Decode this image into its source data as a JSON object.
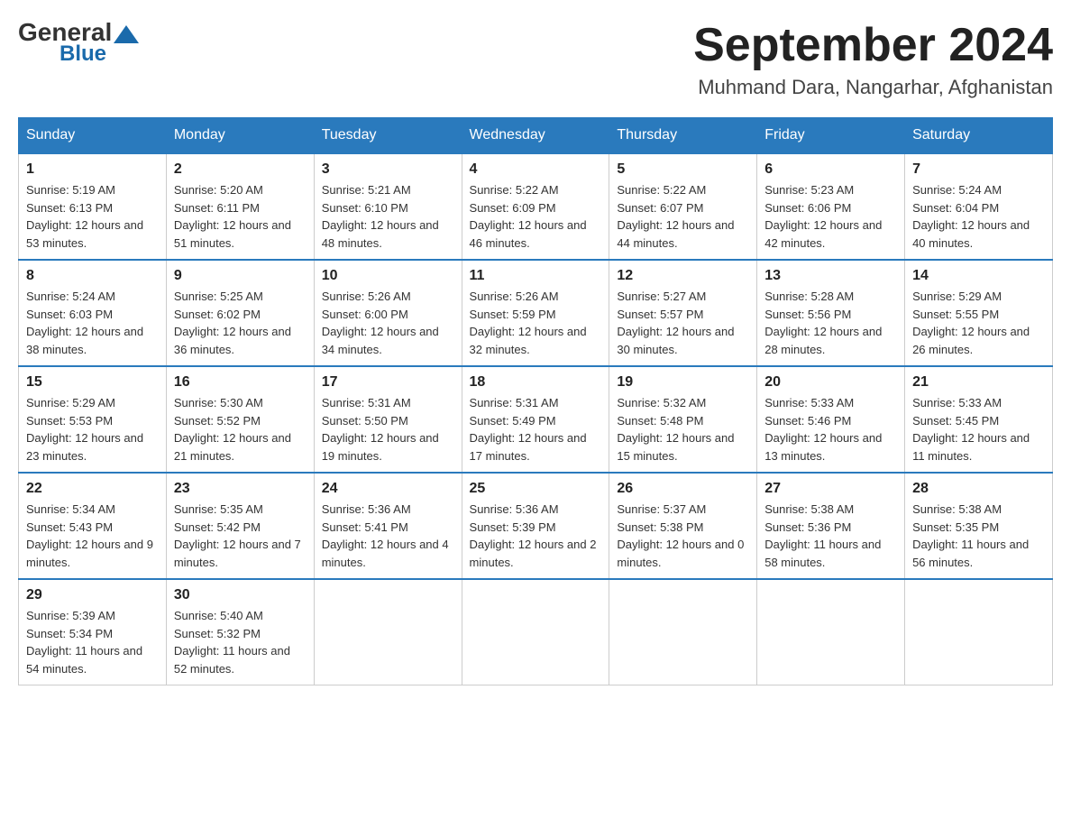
{
  "header": {
    "logo_general": "General",
    "logo_blue": "Blue",
    "month_title": "September 2024",
    "location": "Muhmand Dara, Nangarhar, Afghanistan"
  },
  "weekdays": [
    "Sunday",
    "Monday",
    "Tuesday",
    "Wednesday",
    "Thursday",
    "Friday",
    "Saturday"
  ],
  "weeks": [
    [
      {
        "day": "1",
        "sunrise": "5:19 AM",
        "sunset": "6:13 PM",
        "daylight": "12 hours and 53 minutes."
      },
      {
        "day": "2",
        "sunrise": "5:20 AM",
        "sunset": "6:11 PM",
        "daylight": "12 hours and 51 minutes."
      },
      {
        "day": "3",
        "sunrise": "5:21 AM",
        "sunset": "6:10 PM",
        "daylight": "12 hours and 48 minutes."
      },
      {
        "day": "4",
        "sunrise": "5:22 AM",
        "sunset": "6:09 PM",
        "daylight": "12 hours and 46 minutes."
      },
      {
        "day": "5",
        "sunrise": "5:22 AM",
        "sunset": "6:07 PM",
        "daylight": "12 hours and 44 minutes."
      },
      {
        "day": "6",
        "sunrise": "5:23 AM",
        "sunset": "6:06 PM",
        "daylight": "12 hours and 42 minutes."
      },
      {
        "day": "7",
        "sunrise": "5:24 AM",
        "sunset": "6:04 PM",
        "daylight": "12 hours and 40 minutes."
      }
    ],
    [
      {
        "day": "8",
        "sunrise": "5:24 AM",
        "sunset": "6:03 PM",
        "daylight": "12 hours and 38 minutes."
      },
      {
        "day": "9",
        "sunrise": "5:25 AM",
        "sunset": "6:02 PM",
        "daylight": "12 hours and 36 minutes."
      },
      {
        "day": "10",
        "sunrise": "5:26 AM",
        "sunset": "6:00 PM",
        "daylight": "12 hours and 34 minutes."
      },
      {
        "day": "11",
        "sunrise": "5:26 AM",
        "sunset": "5:59 PM",
        "daylight": "12 hours and 32 minutes."
      },
      {
        "day": "12",
        "sunrise": "5:27 AM",
        "sunset": "5:57 PM",
        "daylight": "12 hours and 30 minutes."
      },
      {
        "day": "13",
        "sunrise": "5:28 AM",
        "sunset": "5:56 PM",
        "daylight": "12 hours and 28 minutes."
      },
      {
        "day": "14",
        "sunrise": "5:29 AM",
        "sunset": "5:55 PM",
        "daylight": "12 hours and 26 minutes."
      }
    ],
    [
      {
        "day": "15",
        "sunrise": "5:29 AM",
        "sunset": "5:53 PM",
        "daylight": "12 hours and 23 minutes."
      },
      {
        "day": "16",
        "sunrise": "5:30 AM",
        "sunset": "5:52 PM",
        "daylight": "12 hours and 21 minutes."
      },
      {
        "day": "17",
        "sunrise": "5:31 AM",
        "sunset": "5:50 PM",
        "daylight": "12 hours and 19 minutes."
      },
      {
        "day": "18",
        "sunrise": "5:31 AM",
        "sunset": "5:49 PM",
        "daylight": "12 hours and 17 minutes."
      },
      {
        "day": "19",
        "sunrise": "5:32 AM",
        "sunset": "5:48 PM",
        "daylight": "12 hours and 15 minutes."
      },
      {
        "day": "20",
        "sunrise": "5:33 AM",
        "sunset": "5:46 PM",
        "daylight": "12 hours and 13 minutes."
      },
      {
        "day": "21",
        "sunrise": "5:33 AM",
        "sunset": "5:45 PM",
        "daylight": "12 hours and 11 minutes."
      }
    ],
    [
      {
        "day": "22",
        "sunrise": "5:34 AM",
        "sunset": "5:43 PM",
        "daylight": "12 hours and 9 minutes."
      },
      {
        "day": "23",
        "sunrise": "5:35 AM",
        "sunset": "5:42 PM",
        "daylight": "12 hours and 7 minutes."
      },
      {
        "day": "24",
        "sunrise": "5:36 AM",
        "sunset": "5:41 PM",
        "daylight": "12 hours and 4 minutes."
      },
      {
        "day": "25",
        "sunrise": "5:36 AM",
        "sunset": "5:39 PM",
        "daylight": "12 hours and 2 minutes."
      },
      {
        "day": "26",
        "sunrise": "5:37 AM",
        "sunset": "5:38 PM",
        "daylight": "12 hours and 0 minutes."
      },
      {
        "day": "27",
        "sunrise": "5:38 AM",
        "sunset": "5:36 PM",
        "daylight": "11 hours and 58 minutes."
      },
      {
        "day": "28",
        "sunrise": "5:38 AM",
        "sunset": "5:35 PM",
        "daylight": "11 hours and 56 minutes."
      }
    ],
    [
      {
        "day": "29",
        "sunrise": "5:39 AM",
        "sunset": "5:34 PM",
        "daylight": "11 hours and 54 minutes."
      },
      {
        "day": "30",
        "sunrise": "5:40 AM",
        "sunset": "5:32 PM",
        "daylight": "11 hours and 52 minutes."
      },
      null,
      null,
      null,
      null,
      null
    ]
  ]
}
